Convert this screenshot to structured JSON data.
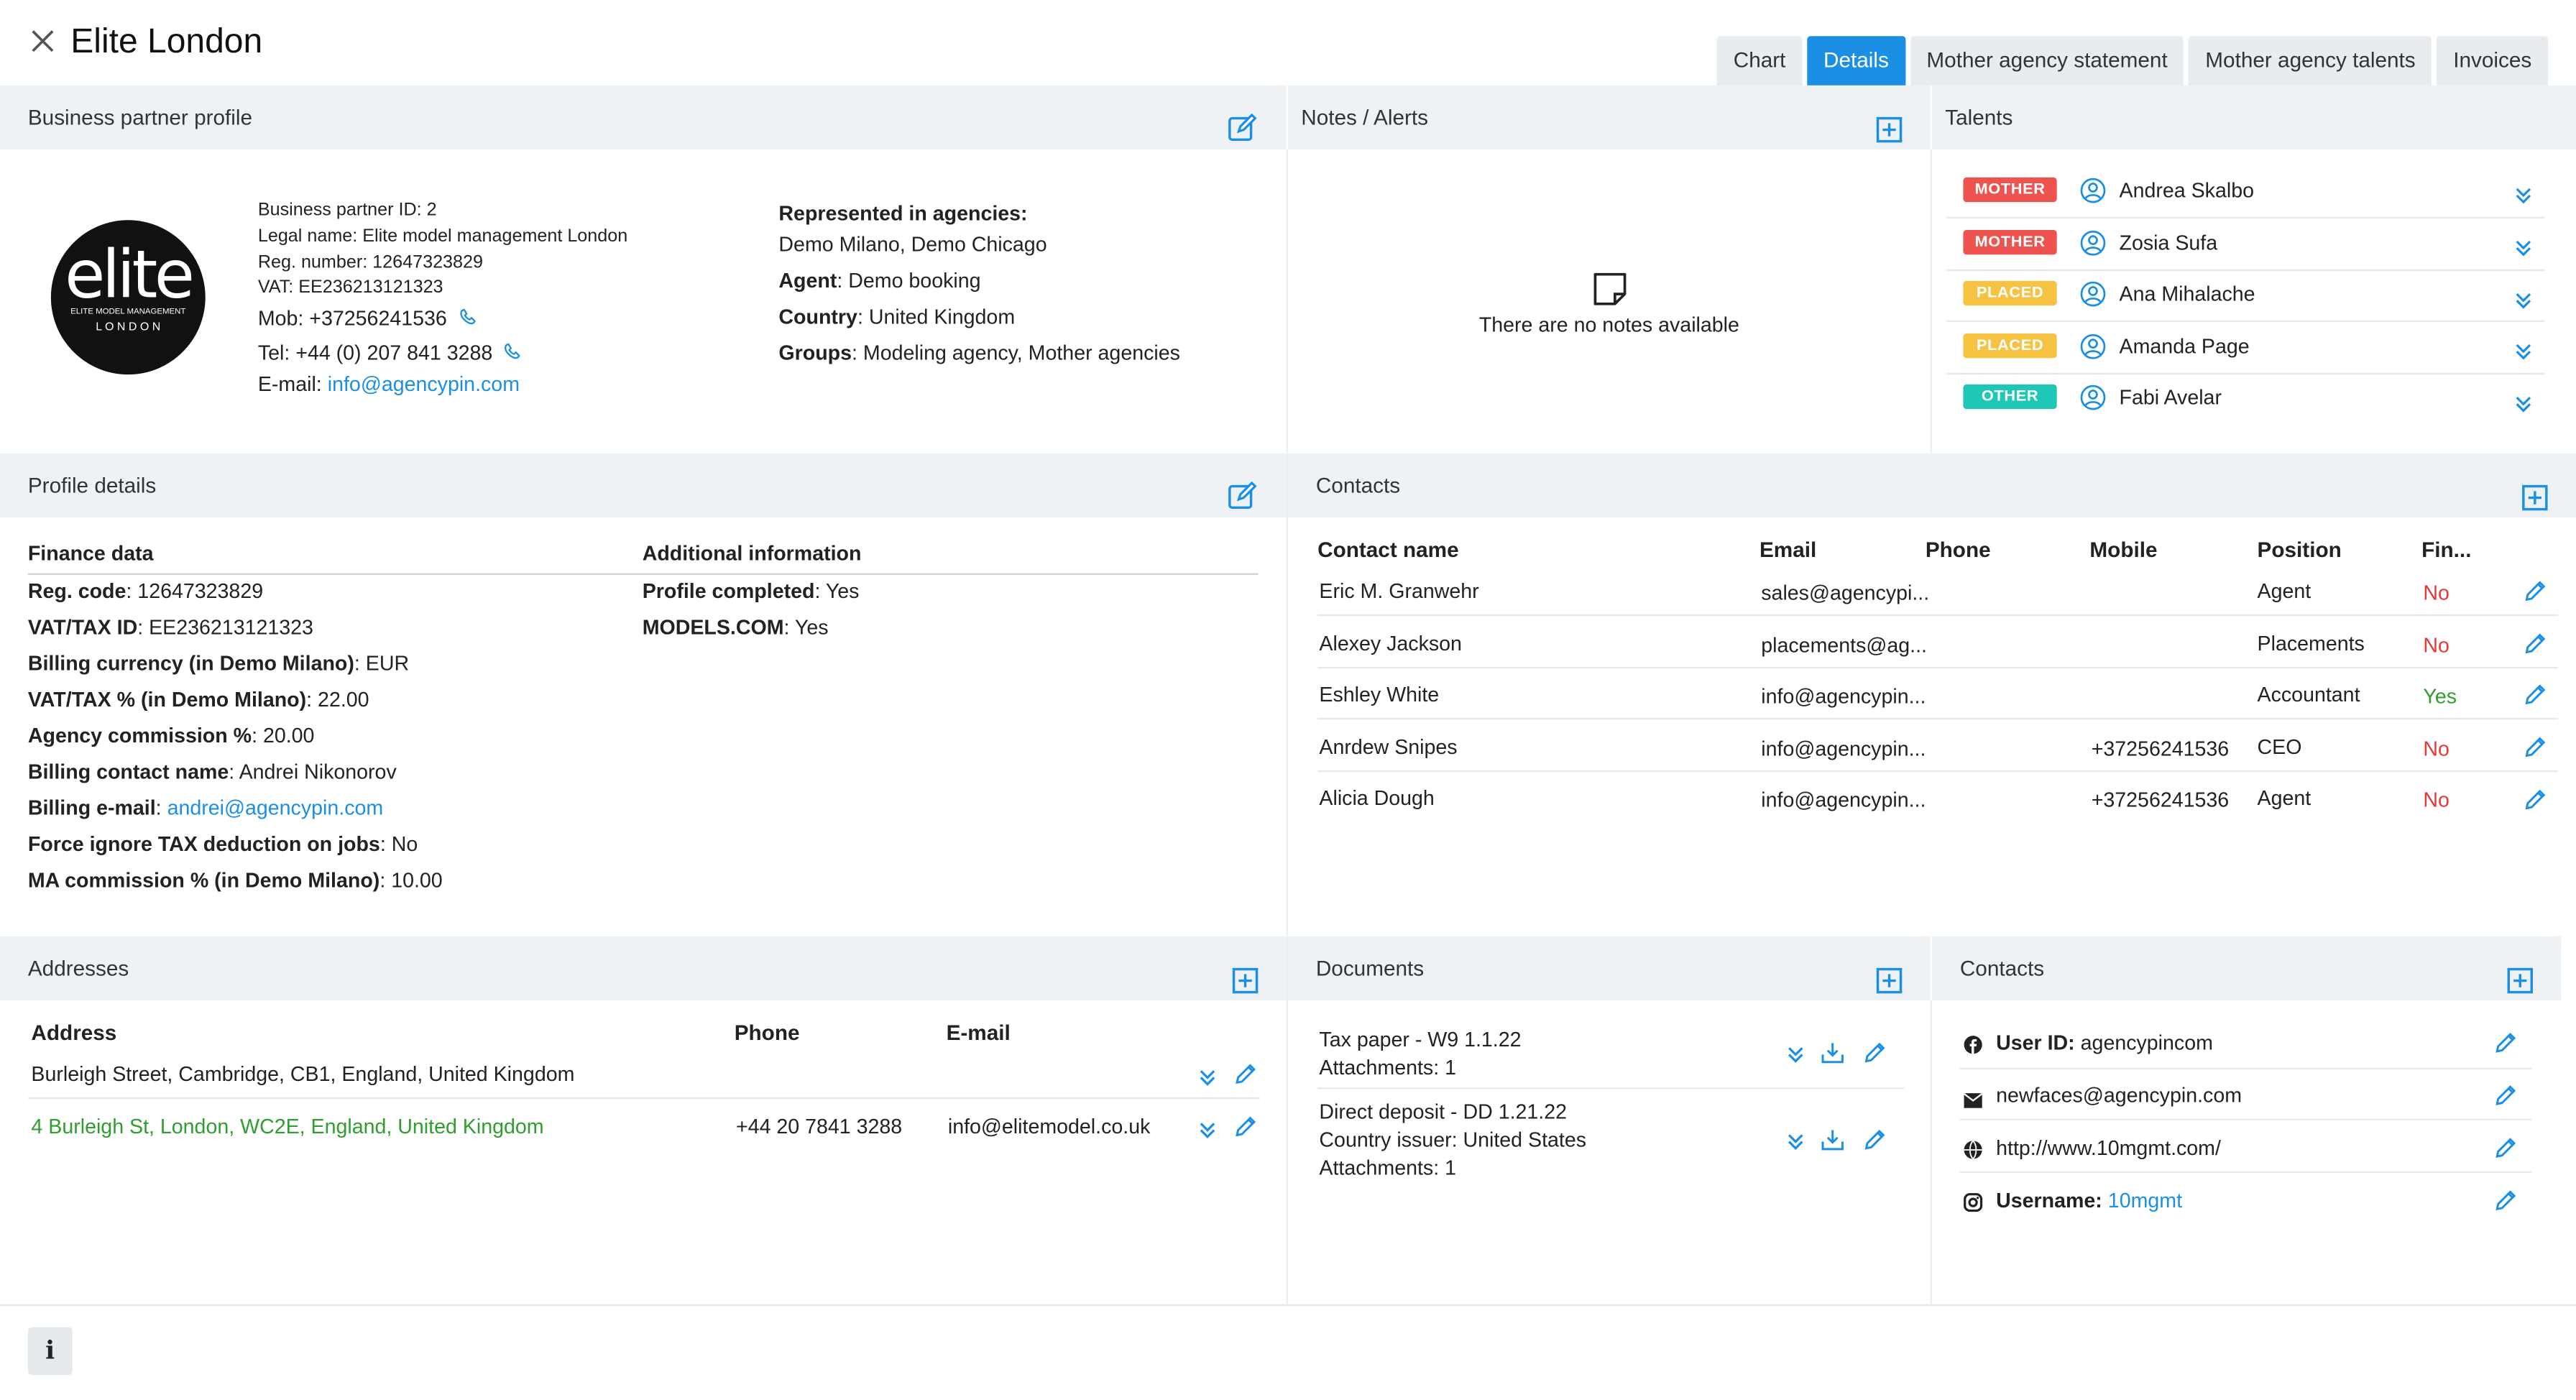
{
  "window": {
    "title": "Elite London"
  },
  "tabs": [
    {
      "label": "Chart",
      "active": false
    },
    {
      "label": "Details",
      "active": true
    },
    {
      "label": "Mother agency statement",
      "active": false
    },
    {
      "label": "Mother agency talents",
      "active": false
    },
    {
      "label": "Invoices",
      "active": false
    }
  ],
  "profile": {
    "header": "Business partner profile",
    "logo_text": "elite",
    "logo_sub1": "ELITE MODEL MANAGEMENT",
    "logo_sub2": "L O N D O N",
    "bp_id": "Business partner ID: 2",
    "legal_name": "Legal name: Elite model management London",
    "reg_number": "Reg. number: 12647323829",
    "vat": "VAT: EE236213121323",
    "mob": "Mob: +37256241536",
    "tel": "Tel: +44 (0) 207 841 3288",
    "email_label": "E-mail:",
    "email": "info@agencypin.com",
    "represented_label": "Represented in agencies:",
    "represented_value": "Demo Milano, Demo Chicago",
    "agent_label": "Agent",
    "agent_value": ": Demo booking",
    "country_label": "Country",
    "country_value": ": United Kingdom",
    "groups_label": "Groups",
    "groups_value": ": Modeling agency, Mother agencies"
  },
  "notes": {
    "header": "Notes / Alerts",
    "empty": "There are no notes available"
  },
  "talents": {
    "header": "Talents",
    "items": [
      {
        "badge": "MOTHER",
        "name": "Andrea Skalbo"
      },
      {
        "badge": "MOTHER",
        "name": "Zosia Sufa"
      },
      {
        "badge": "PLACED",
        "name": "Ana Mihalache"
      },
      {
        "badge": "PLACED",
        "name": "Amanda Page"
      },
      {
        "badge": "OTHER",
        "name": "Fabi Avelar"
      }
    ]
  },
  "profile_details": {
    "header": "Profile details",
    "finance_title": "Finance data",
    "additional_title": "Additional information",
    "finance": [
      {
        "label": "Reg. code",
        "value": ": 12647323829"
      },
      {
        "label": "VAT/TAX ID",
        "value": ": EE236213121323"
      },
      {
        "label": "Billing currency (in Demo Milano)",
        "value": ": EUR"
      },
      {
        "label": "VAT/TAX % (in Demo Milano)",
        "value": ": 22.00"
      },
      {
        "label": "Agency commission %",
        "value": ": 20.00"
      },
      {
        "label": "Billing contact name",
        "value": ": Andrei Nikonorov"
      },
      {
        "label": "Billing e-mail",
        "value": ": ",
        "link": "andrei@agencypin.com"
      },
      {
        "label": "Force ignore TAX deduction on jobs",
        "value": ": No"
      },
      {
        "label": "MA commission % (in Demo Milano)",
        "value": ": 10.00"
      }
    ],
    "additional": [
      {
        "label": "Profile completed",
        "value": ": Yes"
      },
      {
        "label": "MODELS.COM",
        "value": ": Yes"
      }
    ]
  },
  "contacts": {
    "header": "Contacts",
    "columns": [
      "Contact name",
      "Email",
      "Phone",
      "Mobile",
      "Position",
      "Fin..."
    ],
    "rows": [
      {
        "name": "Eric M. Granwehr",
        "email": "sales@agencypi...",
        "phone": "",
        "mobile": "",
        "position": "Agent",
        "fin": "No"
      },
      {
        "name": "Alexey Jackson",
        "email": "placements@ag...",
        "phone": "",
        "mobile": "",
        "position": "Placements",
        "fin": "No"
      },
      {
        "name": "Eshley White",
        "email": "info@agencypin...",
        "phone": "",
        "mobile": "",
        "position": "Accountant",
        "fin": "Yes"
      },
      {
        "name": "Anrdew Snipes",
        "email": "info@agencypin...",
        "phone": "",
        "mobile": "+37256241536",
        "position": "CEO",
        "fin": "No"
      },
      {
        "name": "Alicia Dough",
        "email": "info@agencypin...",
        "phone": "",
        "mobile": "+37256241536",
        "position": "Agent",
        "fin": "No"
      }
    ]
  },
  "addresses": {
    "header": "Addresses",
    "columns": [
      "Address",
      "Phone",
      "E-mail"
    ],
    "rows": [
      {
        "address": "Burleigh Street, Cambridge, CB1, England, United Kingdom",
        "phone": "",
        "email": "",
        "primary": false
      },
      {
        "address": "4 Burleigh St, London, WC2E, England, United Kingdom",
        "phone": "+44 20 7841 3288",
        "email": "info@elitemodel.co.uk",
        "primary": true
      }
    ]
  },
  "documents": {
    "header": "Documents",
    "items": [
      {
        "line1": "Tax paper - W9 1.1.22",
        "line2": "Attachments: 1",
        "line3": ""
      },
      {
        "line1": "Direct deposit - DD 1.21.22",
        "line2": "Country issuer: United States",
        "line3": "Attachments: 1"
      }
    ]
  },
  "social": {
    "header": "Contacts",
    "items": [
      {
        "icon": "facebook-icon",
        "label": "User ID:",
        "value": "agencypincom",
        "link": false
      },
      {
        "icon": "envelope-icon",
        "label": "",
        "value": "newfaces@agencypin.com",
        "link": true
      },
      {
        "icon": "globe-icon",
        "label": "",
        "value": "http://www.10mgmt.com/",
        "link": true
      },
      {
        "icon": "instagram-icon",
        "label": "Username:",
        "value": "10mgmt",
        "link": true
      }
    ]
  },
  "footer": {
    "info_label": "i"
  },
  "colors": {
    "accent": "#1a8fe3",
    "mother": "#ef5350",
    "placed": "#f5c242",
    "other": "#1fc7b6",
    "header_bg": "#eef2f5"
  }
}
